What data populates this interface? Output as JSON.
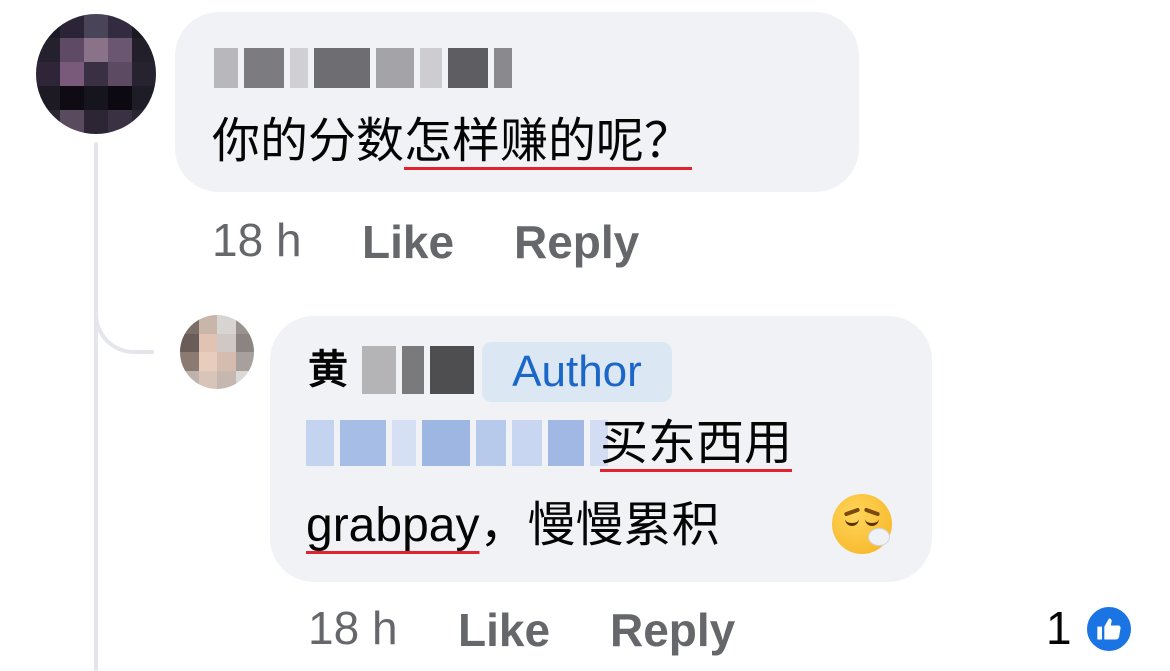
{
  "comment": {
    "text_plain": "你的分数",
    "text_marked": "怎样赚的呢？",
    "time": "18 h",
    "like_label": "Like",
    "reply_label": "Reply"
  },
  "reply": {
    "author_visible_char": "黄",
    "author_badge": "Author",
    "line1_marked": "买东西用",
    "line2_marked": "grabpay",
    "line2_plain": "，慢慢累积",
    "emoji_icon": "face-exhaling-emoji",
    "time": "18 h",
    "like_label": "Like",
    "reply_label": "Reply",
    "reaction_count": "1",
    "reaction_icon": "like-icon"
  },
  "colors": {
    "bubble": "#f0f2f5",
    "meta_text": "#65676b",
    "author_badge_bg": "#dbe7f2",
    "author_badge_text": "#1b66c9",
    "underline": "#e0242f",
    "like_blue": "#1b74e4"
  }
}
